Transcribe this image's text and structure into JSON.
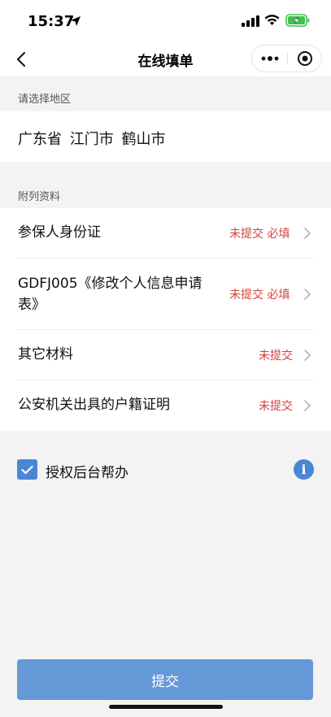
{
  "status_bar": {
    "time": "15:37"
  },
  "nav": {
    "title": "在线填单"
  },
  "region": {
    "section_label": "请选择地区",
    "value": "广东省 江门市 鹤山市"
  },
  "attachments": {
    "section_label": "附列资料",
    "items": [
      {
        "title": "参保人身份证",
        "status": "未提交 必填"
      },
      {
        "title_line1": "GDFJ005《修改个人信息申请",
        "title_line2": "表》",
        "status": "未提交 必填"
      },
      {
        "title": "其它材料",
        "status": "未提交"
      },
      {
        "title": "公安机关出具的户籍证明",
        "status": "未提交"
      }
    ]
  },
  "authorize": {
    "label": "授权后台帮办",
    "checked": true,
    "info_glyph": "i"
  },
  "submit": {
    "label": "提交"
  },
  "colors": {
    "accent": "#4a86d6",
    "submit_bg": "#6599d8",
    "status_red": "#d4413b",
    "background": "#f3f3f3"
  },
  "icons": [
    "location-arrow-icon",
    "cellular-signal-icon",
    "wifi-icon",
    "battery-charging-icon",
    "back-chevron-icon",
    "more-dots-icon",
    "close-target-icon",
    "chevron-right-icon",
    "checkmark-icon",
    "info-icon"
  ]
}
